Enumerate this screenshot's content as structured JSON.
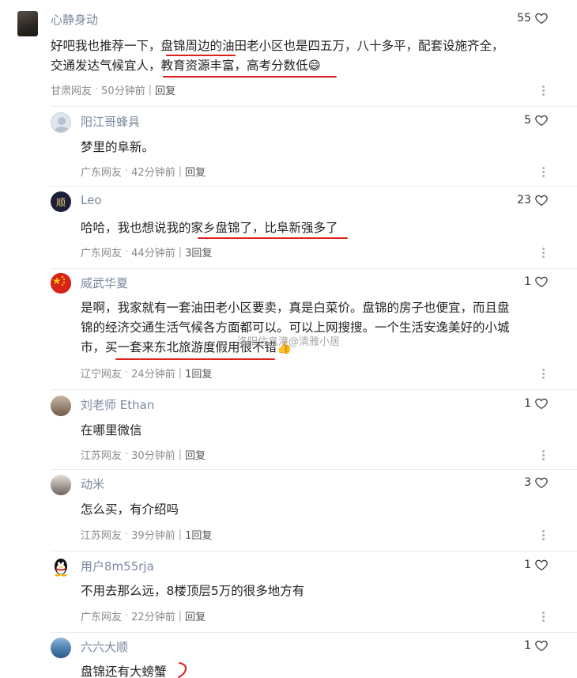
{
  "comments": [
    {
      "name": "心静身动",
      "likes": "55",
      "text_lines": [
        "好吧我也推荐一下，盘锦周边的油田老小区也是四五万，八十多平，配套设施齐全，",
        "交通发达气候宜人，教育资源丰富，高考分数低😄"
      ],
      "location": "甘肃网友",
      "time": "50分钟前",
      "reply": "回复"
    },
    {
      "name": "阳江哥蜂具",
      "likes": "5",
      "text_lines": [
        "梦里的阜新。"
      ],
      "location": "广东网友",
      "time": "42分钟前",
      "reply": "回复"
    },
    {
      "name": "Leo",
      "likes": "23",
      "text_lines": [
        "哈哈，我也想说我的家乡盘锦了，比阜新强多了"
      ],
      "location": "广东网友",
      "time": "44分钟前",
      "reply": "3回复"
    },
    {
      "name": "威武华夏",
      "likes": "1",
      "text_lines": [
        "是啊，我家就有一套油田老小区要卖，真是白菜价。盘锦的房子也便宜，而且盘",
        "锦的经济交通生活气候各方面都可以。可以上网搜搜。一个生活安逸美好的小城",
        "市，买一套来东北旅游度假用很不错👍"
      ],
      "location": "辽宁网友",
      "time": "24分钟前",
      "reply": "1回复"
    },
    {
      "name": "刘老师 Ethan",
      "likes": "1",
      "text_lines": [
        "在哪里微信"
      ],
      "location": "江苏网友",
      "time": "30分钟前",
      "reply": "回复"
    },
    {
      "name": "动米",
      "likes": "3",
      "text_lines": [
        "怎么买，有介绍吗"
      ],
      "location": "江苏网友",
      "time": "39分钟前",
      "reply": "1回复"
    },
    {
      "name": "用户8m55rja",
      "likes": "1",
      "text_lines": [
        "不用去那么远，8楼顶层5万的很多地方有"
      ],
      "location": "广东网友",
      "time": "22分钟前",
      "reply": "回复"
    },
    {
      "name": "六六大顺",
      "likes": "1",
      "text_lines": [
        "盘锦还有大螃蟹"
      ],
      "location": "",
      "time": "",
      "reply": ""
    }
  ],
  "watermark": "洛阳信息港@清雅小居",
  "icons": {
    "heart": "heart-outline-icon",
    "more": "more-vertical-icon"
  },
  "colors": {
    "annotation_red": "#e0201a",
    "name_gray": "#7a8aa0",
    "meta_gray": "#8a8a8a"
  }
}
